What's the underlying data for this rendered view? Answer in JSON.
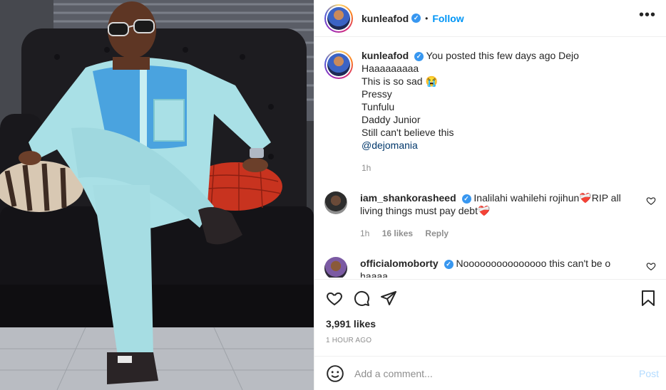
{
  "header": {
    "username": "kunleafod",
    "separator": "•",
    "follow_label": "Follow",
    "more_label": "•••"
  },
  "caption": {
    "username": "kunleafod",
    "lines": [
      "You posted this few days ago Dejo",
      "Haaaaaaaaa",
      "This is so sad 😭",
      "Pressy",
      "Tunfulu",
      "Daddy Junior",
      "Still can't believe this"
    ],
    "mention": "@dejomania",
    "time": "1h"
  },
  "comments": [
    {
      "username": "iam_shankorasheed",
      "text": "Inalilahi wahilehi rojihun❤️‍🩹RIP all living things must pay debt❤️‍🩹",
      "time": "1h",
      "likes": "16 likes",
      "reply": "Reply"
    },
    {
      "username": "officialomoborty",
      "text": "Nooooooooooooooo this can't be o haaaa",
      "time": "",
      "likes": "",
      "reply": ""
    }
  ],
  "actions": {
    "likes": "3,991 likes",
    "timestamp": "1 HOUR AGO"
  },
  "composer": {
    "placeholder": "Add a comment...",
    "post_label": "Post"
  },
  "colors": {
    "accent": "#0095f6",
    "verified": "#3897f0",
    "muted": "#8e8e8e",
    "post_disabled": "#b3dbff"
  }
}
